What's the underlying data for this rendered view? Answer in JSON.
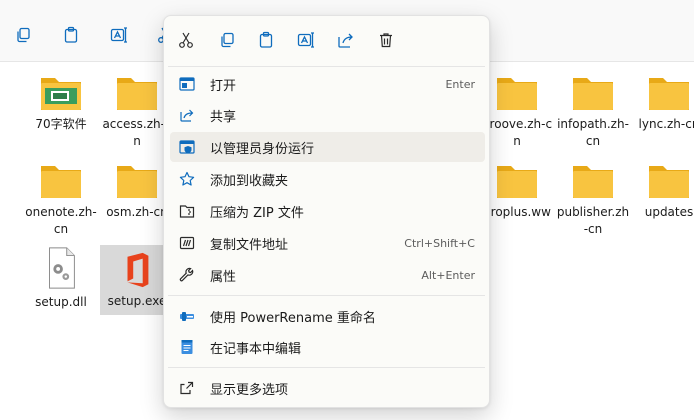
{
  "toolbar": {
    "buttons": [
      "copy-icon",
      "paste-icon",
      "rename-icon"
    ]
  },
  "files": [
    {
      "name": "70字软件",
      "type": "folder-app"
    },
    {
      "name": "access.zh-cn",
      "type": "folder"
    },
    {
      "name": "groove.zh-cn",
      "type": "folder"
    },
    {
      "name": "infopath.zh-cn",
      "type": "folder"
    },
    {
      "name": "lync.zh-cn",
      "type": "folder"
    },
    {
      "name": "onenote.zh-cn",
      "type": "folder"
    },
    {
      "name": "osm.zh-cn",
      "type": "folder"
    },
    {
      "name": "proplus.ww",
      "type": "folder"
    },
    {
      "name": "publisher.zh-cn",
      "type": "folder"
    },
    {
      "name": "updates",
      "type": "folder"
    },
    {
      "name": "setup.dll",
      "type": "dll"
    },
    {
      "name": "setup.exe",
      "type": "office-exe",
      "selected": true
    }
  ],
  "context_menu": {
    "quick_actions": [
      "cut-icon",
      "copy-icon",
      "paste-icon",
      "rename-icon",
      "share-icon",
      "delete-icon"
    ],
    "items": [
      {
        "label": "打开",
        "shortcut": "Enter",
        "icon": "open-icon"
      },
      {
        "label": "共享",
        "shortcut": "",
        "icon": "share-icon"
      },
      {
        "label": "以管理员身份运行",
        "shortcut": "",
        "icon": "shield-icon",
        "hover": true
      },
      {
        "label": "添加到收藏夹",
        "shortcut": "",
        "icon": "star-icon"
      },
      {
        "label": "压缩为 ZIP 文件",
        "shortcut": "",
        "icon": "zip-icon"
      },
      {
        "label": "复制文件地址",
        "shortcut": "Ctrl+Shift+C",
        "icon": "copy-path-icon"
      },
      {
        "label": "属性",
        "shortcut": "Alt+Enter",
        "icon": "wrench-icon"
      },
      {
        "label": "使用 PowerRename 重命名",
        "shortcut": "",
        "icon": "powerrename-icon"
      },
      {
        "label": "在记事本中编辑",
        "shortcut": "",
        "icon": "notepad-icon"
      },
      {
        "label": "显示更多选项",
        "shortcut": "",
        "icon": "more-options-icon"
      }
    ]
  },
  "colors": {
    "folder": "#f8c440",
    "folder_light": "#ffd866",
    "office_red": "#e8421c",
    "accent_blue": "#0f6cbd"
  }
}
